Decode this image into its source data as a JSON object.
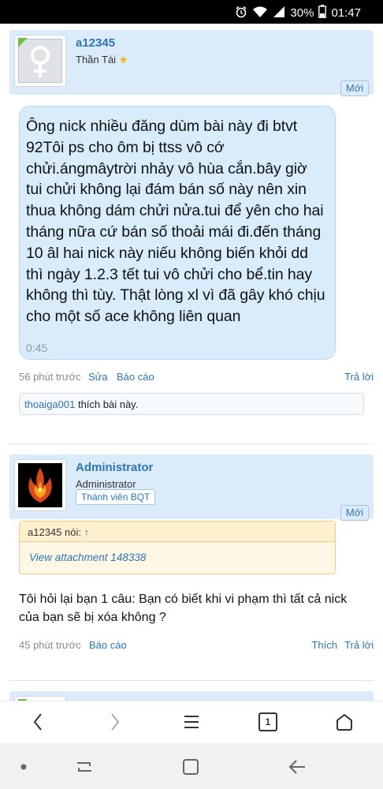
{
  "status": {
    "battery": "30%",
    "time": "01:47"
  },
  "posts": [
    {
      "username": "a12345",
      "usertitle": "Thần Tài",
      "new_label": "Mới",
      "message": "Ông nick nhiều đăng dùm  bài này đi btvt 92Tôi ps cho ôm bị ttss vô cớ chửi.ángmâytrời nhảy vô hùa cắn.bây giờ tui chửi không lại đám bán số này nên xin thua không dám chửi nửa.tui để yên cho hai tháng nữa cứ bán số thoải mái đi.đến tháng 10 âl hai nick này niếu không biến khỏi dd thì ngày 1.2.3 tết tui vô chửi cho bể.tin hay không thì tùy. Thật lòng xl vì đã gây khó chịu cho một số ace không liên quan",
      "audio_time": "0:45",
      "timestamp": "56 phút trước",
      "edit_label": "Sửa",
      "report_label": "Báo cáo",
      "reply_label": "Trả lời",
      "liker": "thoaiga001",
      "likes_text": "thích bài này."
    },
    {
      "username": "Administrator",
      "usertitle": "Administrator",
      "badge": "Thành viên BQT",
      "new_label": "Mới",
      "quote_author": "a12345 nói:",
      "quote_arrow": "↑",
      "quote_body": "View attachment 148338",
      "message": "Tôi hỏi lại bạn 1 câu: Bạn có biết khi vi phạm thì tất cả nick của bạn sẽ bị xóa không ?",
      "timestamp": "45 phút trước",
      "report_label": "Báo cáo",
      "like_label": "Thích",
      "reply_label": "Trả lời"
    }
  ],
  "browser": {
    "tab_count": "1"
  }
}
